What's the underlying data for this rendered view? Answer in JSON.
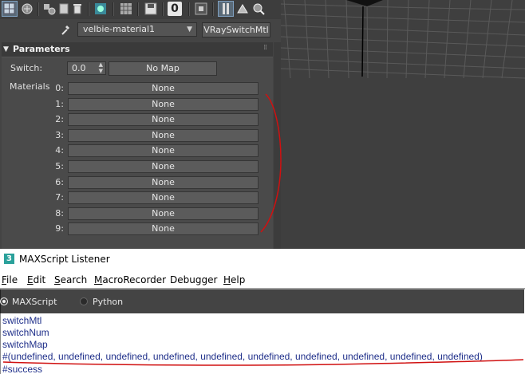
{
  "toolbar": {
    "icons": [
      "get-material-icon",
      "put-to-scene-icon",
      "assign-material-icon",
      "reset-map-icon",
      "delete-icon",
      "make-unique-icon",
      "show-in-viewport-icon",
      "save-to-library-icon",
      "material-id-channel-icon",
      "show-end-result-icon",
      "go-to-parent-icon",
      "go-forward-to-sibling-icon",
      "pick-from-object-icon"
    ],
    "material_id_label": "0"
  },
  "material": {
    "name": "velbie-material1",
    "type": "VRaySwitchMtl"
  },
  "parameters": {
    "title": "Parameters",
    "switch_label": "Switch:",
    "switch_value": "0.0",
    "switch_map": "No Map",
    "materials_label": "Materials",
    "slots": [
      {
        "index": "0:",
        "value": "None"
      },
      {
        "index": "1:",
        "value": "None"
      },
      {
        "index": "2:",
        "value": "None"
      },
      {
        "index": "3:",
        "value": "None"
      },
      {
        "index": "4:",
        "value": "None"
      },
      {
        "index": "5:",
        "value": "None"
      },
      {
        "index": "6:",
        "value": "None"
      },
      {
        "index": "7:",
        "value": "None"
      },
      {
        "index": "8:",
        "value": "None"
      },
      {
        "index": "9:",
        "value": "None"
      }
    ]
  },
  "listener": {
    "icon_label": "3",
    "title": "MAXScript Listener",
    "menu": [
      {
        "label": "File",
        "u": "F",
        "rest": "ile"
      },
      {
        "label": "Edit",
        "u": "E",
        "rest": "dit"
      },
      {
        "label": "Search",
        "u": "S",
        "rest": "earch"
      },
      {
        "label": "MacroRecorder",
        "u": "M",
        "rest": "acroRecorder"
      },
      {
        "label": "Debugger",
        "u": "",
        "rest": "Debugger"
      },
      {
        "label": "Help",
        "u": "H",
        "rest": "elp"
      }
    ],
    "languages": [
      {
        "label": "MAXScript",
        "selected": true
      },
      {
        "label": "Python",
        "selected": false
      }
    ],
    "output": [
      "switchMtl",
      "switchNum",
      "switchMap",
      "#(undefined, undefined, undefined, undefined, undefined, undefined, undefined, undefined, undefined, undefined)",
      "#success"
    ]
  },
  "colors": {
    "ui_dark": "#444444",
    "output_text": "#1f2f8a",
    "annotation": "#d01010"
  }
}
